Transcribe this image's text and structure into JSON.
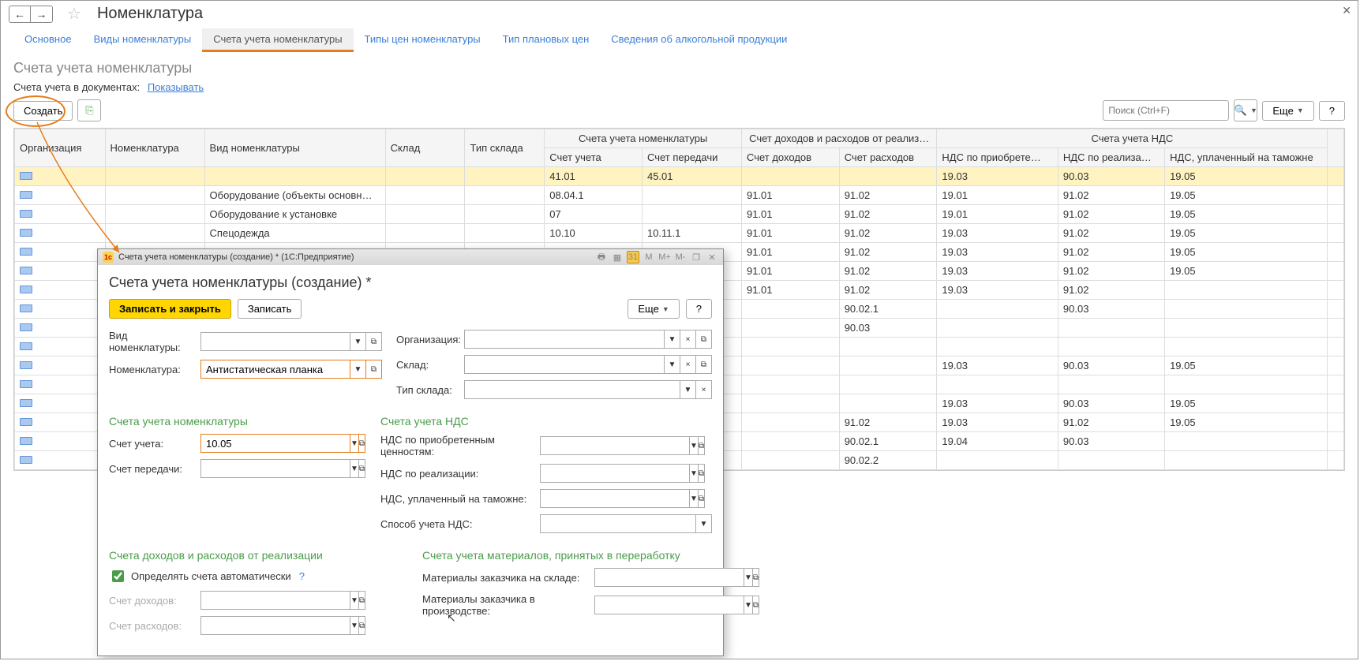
{
  "titlebar": {
    "title": "Номенклатура"
  },
  "tabs": [
    {
      "label": "Основное",
      "active": false
    },
    {
      "label": "Виды номенклатуры",
      "active": false
    },
    {
      "label": "Счета учета номенклатуры",
      "active": true
    },
    {
      "label": "Типы цен номенклатуры",
      "active": false
    },
    {
      "label": "Тип плановых цен",
      "active": false
    },
    {
      "label": "Сведения об алкогольной продукции",
      "active": false
    }
  ],
  "sub_title": "Счета учета номенклатуры",
  "filter": {
    "label": "Счета учета в документах:",
    "link": "Показывать"
  },
  "toolbar": {
    "create": "Создать",
    "search_placeholder": "Поиск (Ctrl+F)",
    "more": "Еще",
    "help": "?"
  },
  "grid": {
    "header_groups": {
      "nomenclature_accounts": "Счета учета номенклатуры",
      "income_expense": "Счет доходов и расходов от реализ…",
      "vat_accounts": "Счета учета НДС"
    },
    "columns": [
      "Организация",
      "Номенклатура",
      "Вид номенклатуры",
      "Склад",
      "Тип склада",
      "Счет учета",
      "Счет передачи",
      "Счет доходов",
      "Счет расходов",
      "НДС по приобрете…",
      "НДС по реализа…",
      "НДС, уплаченный на таможне"
    ],
    "rows": [
      {
        "h": true,
        "c": [
          "",
          "",
          "",
          "",
          "",
          "41.01",
          "45.01",
          "",
          "",
          "19.03",
          "90.03",
          "19.05"
        ]
      },
      {
        "c": [
          "",
          "",
          "Оборудование (объекты основн…",
          "",
          "",
          "08.04.1",
          "",
          "91.01",
          "91.02",
          "19.01",
          "91.02",
          "19.05"
        ]
      },
      {
        "c": [
          "",
          "",
          "Оборудование к установке",
          "",
          "",
          "07",
          "",
          "91.01",
          "91.02",
          "19.01",
          "91.02",
          "19.05"
        ]
      },
      {
        "c": [
          "",
          "",
          "Спецодежда",
          "",
          "",
          "10.10",
          "10.11.1",
          "91.01",
          "91.02",
          "19.03",
          "91.02",
          "19.05"
        ]
      },
      {
        "c": [
          "",
          "",
          "",
          "",
          "",
          "",
          "",
          "91.01",
          "91.02",
          "19.03",
          "91.02",
          "19.05"
        ]
      },
      {
        "c": [
          "",
          "",
          "",
          "",
          "",
          "",
          "",
          "91.01",
          "91.02",
          "19.03",
          "91.02",
          "19.05"
        ]
      },
      {
        "c": [
          "",
          "",
          "",
          "",
          "",
          "",
          "",
          "91.01",
          "91.02",
          "19.03",
          "91.02",
          ""
        ]
      },
      {
        "c": [
          "",
          "",
          "",
          "",
          "",
          "",
          "",
          "",
          "90.02.1",
          "",
          "90.03",
          ""
        ]
      },
      {
        "c": [
          "",
          "",
          "",
          "",
          "",
          "",
          "",
          "",
          "90.03",
          "",
          "",
          ""
        ]
      },
      {
        "c": [
          "",
          "",
          "",
          "",
          "",
          "",
          "",
          "",
          "",
          "",
          "",
          ""
        ]
      },
      {
        "c": [
          "",
          "",
          "",
          "",
          "",
          "",
          "",
          "",
          "",
          "19.03",
          "90.03",
          "19.05"
        ]
      },
      {
        "c": [
          "",
          "",
          "",
          "",
          "",
          "",
          "",
          "",
          "",
          "",
          "",
          ""
        ]
      },
      {
        "c": [
          "",
          "",
          "",
          "",
          "",
          "",
          "",
          "",
          "",
          "19.03",
          "90.03",
          "19.05"
        ]
      },
      {
        "c": [
          "",
          "",
          "",
          "",
          "",
          "",
          "",
          "",
          "91.02",
          "19.03",
          "91.02",
          "19.05"
        ]
      },
      {
        "c": [
          "",
          "",
          "",
          "",
          "",
          "",
          "",
          "",
          "90.02.1",
          "19.04",
          "90.03",
          ""
        ]
      },
      {
        "c": [
          "",
          "",
          "",
          "",
          "",
          "",
          "",
          "",
          "90.02.2",
          "",
          "",
          ""
        ]
      }
    ]
  },
  "dialog": {
    "window_title": "Счета учета номенклатуры (создание) *  (1С:Предприятие)",
    "heading": "Счета учета номенклатуры (создание) *",
    "save_close": "Записать и закрыть",
    "save": "Записать",
    "more": "Еще",
    "help": "?",
    "labels": {
      "vid": "Вид номенклатуры:",
      "org": "Организация:",
      "nom": "Номенклатура:",
      "sklad": "Склад:",
      "tip_sklada": "Тип склада:",
      "sec_nom": "Счета учета номенклатуры",
      "sec_nds": "Счета учета НДС",
      "schet_ucheta": "Счет учета:",
      "schet_peredachi": "Счет передачи:",
      "nds_priobr": "НДС по приобретенным ценностям:",
      "nds_real": "НДС по реализации:",
      "nds_tam": "НДС, уплаченный на таможне:",
      "sposob_nds": "Способ учета НДС:",
      "sec_doh": "Счета доходов и расходов от реализации",
      "auto_check": "Определять счета автоматически",
      "schet_doh": "Счет доходов:",
      "schet_rash": "Счет расходов:",
      "sec_mat": "Счета учета материалов, принятых в переработку",
      "mat_sklad": "Материалы заказчика на складе:",
      "mat_proizv": "Материалы заказчика в производстве:"
    },
    "values": {
      "nom": "Антистатическая планка",
      "schet_ucheta": "10.05"
    }
  }
}
